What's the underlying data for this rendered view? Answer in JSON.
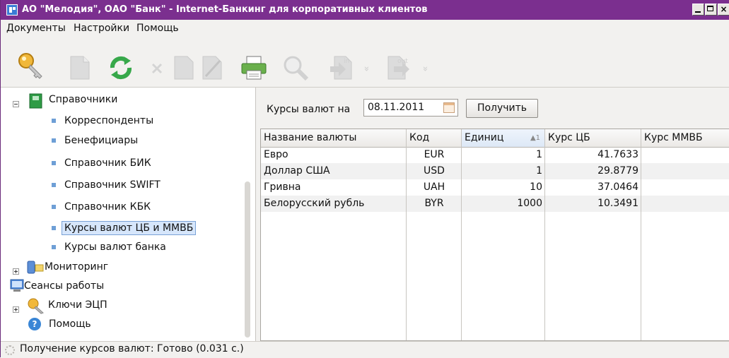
{
  "window": {
    "title": "АО \"Мелодия\", ОАО \"Банк\" - Internet-Банкинг для корпоративных клиентов",
    "close_glyph": "×"
  },
  "menu": {
    "items": [
      "Документы",
      "Настройки",
      "Помощь"
    ]
  },
  "toolbar": {
    "in_label": "in",
    "out_label": "out",
    "dropdown_glyph": "»"
  },
  "tree": {
    "root": "Справочники",
    "children": [
      "Корреспонденты",
      "Бенефициары",
      "Справочник БИК",
      "Справочник SWIFT",
      "Справочник КБК",
      "Курсы валют ЦБ и ММВБ",
      "Курсы валют банка"
    ],
    "other": [
      "Мониторинг",
      "Сеансы работы",
      "Ключи ЭЦП",
      "Помощь"
    ],
    "help_glyph": "?"
  },
  "rates": {
    "label": "Курсы валют на",
    "date": "08.11.2011",
    "get_button": "Получить",
    "columns": [
      "Название валюты",
      "Код",
      "Единиц",
      "Курс ЦБ",
      "Курс ММВБ"
    ],
    "sort_indicator": "▲1",
    "rows": [
      [
        "Евро",
        "EUR",
        "1",
        "41.7633",
        ""
      ],
      [
        "Доллар США",
        "USD",
        "1",
        "29.8779",
        ""
      ],
      [
        "Гривна",
        "UAH",
        "10",
        "37.0464",
        ""
      ],
      [
        "Белорусский рубль",
        "BYR",
        "1000",
        "10.3491",
        ""
      ]
    ]
  },
  "status": {
    "text": "Получение курсов валют: Готово (0.031 с.)"
  },
  "colors": {
    "titlebar": "#7b2f8f",
    "selection": "#d6e6fb",
    "bullet": "#6e9fd6"
  }
}
